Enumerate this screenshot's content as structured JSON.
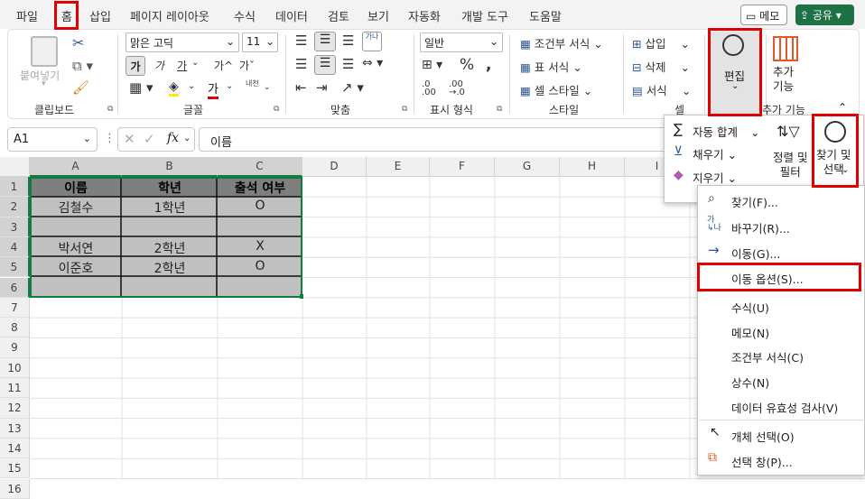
{
  "menu_tabs": [
    "파일",
    "홈",
    "삽입",
    "페이지 레이아웃",
    "수식",
    "데이터",
    "검토",
    "보기",
    "자동화",
    "개발 도구",
    "도움말"
  ],
  "comment_btn": "메모",
  "share_btn": "공유",
  "clipboard": {
    "paste": "붙여넣기",
    "label": "클립보드"
  },
  "font": {
    "name": "맑은 고딕",
    "size": "11",
    "bold": "가",
    "italic": "가",
    "underline": "가",
    "grow": "가^",
    "shrink": "가ˇ",
    "phonetic": "내천",
    "label": "글꼴"
  },
  "align": {
    "label": "맞춤",
    "wrap": "가나"
  },
  "number": {
    "format": "일반",
    "label": "표시 형식"
  },
  "styles": {
    "cond": "조건부 서식",
    "table": "표 서식",
    "cell": "셀 스타일",
    "label": "스타일"
  },
  "cells": {
    "insert": "삽입",
    "delete": "삭제",
    "format": "서식",
    "label": "셀"
  },
  "editing": {
    "label": "편집",
    "addins": "추가\n기능",
    "addins_group": "추가 기능"
  },
  "formula": {
    "namebox": "A1",
    "content": "이름",
    "fx": "fx"
  },
  "columns": [
    "A",
    "B",
    "C",
    "D",
    "E",
    "F",
    "G",
    "H",
    "I"
  ],
  "rows": [
    "1",
    "2",
    "3",
    "4",
    "5",
    "6",
    "7",
    "8",
    "9",
    "10",
    "11",
    "12",
    "13",
    "14",
    "15",
    "16"
  ],
  "table": {
    "header": [
      "이름",
      "학년",
      "출석 여부"
    ],
    "rows": [
      [
        "김철수",
        "1학년",
        "O"
      ],
      [
        "",
        "",
        ""
      ],
      [
        "박서연",
        "2학년",
        "X"
      ],
      [
        "이준호",
        "2학년",
        "O"
      ],
      [
        "",
        "",
        ""
      ]
    ]
  },
  "edit_popup": {
    "autosum": "자동 합계",
    "fill": "채우기",
    "clear": "지우기",
    "sort": "정렬 및\n필터",
    "find": "찾기 및\n선택"
  },
  "find_menu": [
    "찾기(F)...",
    "바꾸기(R)...",
    "이동(G)...",
    "이동 옵션(S)...",
    "수식(U)",
    "메모(N)",
    "조건부 서식(C)",
    "상수(N)",
    "데이터 유효성 검사(V)",
    "개체 선택(O)",
    "선택 창(P)..."
  ]
}
